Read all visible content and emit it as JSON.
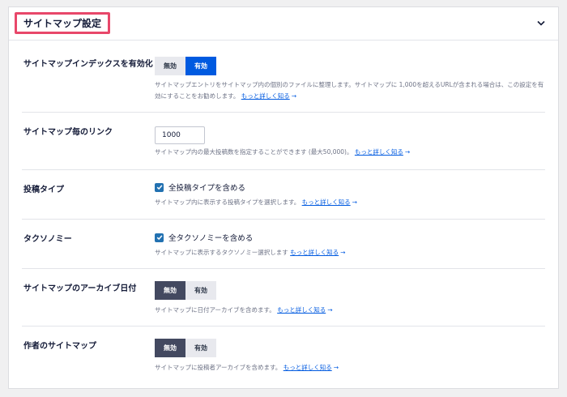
{
  "section": {
    "title": "サイトマップ設定",
    "collapse_icon": "chevron-down-icon"
  },
  "colors": {
    "accent": "#005ae0",
    "highlight_border": "#e8476a",
    "dark_toggle": "#434960"
  },
  "learn_more": "もっと詳しく知る",
  "arrow": "→",
  "rows": {
    "index": {
      "label": "サイトマップインデックスを有効化",
      "off": "無効",
      "on": "有効",
      "selected": "on",
      "desc": "サイトマップエントリをサイトマップ内の個別のファイルに整理します。サイトマップに 1,000を超えるURLが含まれる場合は、この設定を有効にすることをお勧めします。"
    },
    "links": {
      "label": "サイトマップ毎のリンク",
      "value": "1000",
      "desc": "サイトマップ内の最大投稿数を指定することができます (最大50,000)。"
    },
    "post_types": {
      "label": "投稿タイプ",
      "checkbox": "全投稿タイプを含める",
      "checked": true,
      "desc": "サイトマップ内に表示する投稿タイプを選択します。"
    },
    "taxonomies": {
      "label": "タクソノミー",
      "checkbox": "全タクソノミーを含める",
      "checked": true,
      "desc": "サイトマップに表示するタクソノミー選択します"
    },
    "archive": {
      "label": "サイトマップのアーカイブ日付",
      "off": "無効",
      "on": "有効",
      "selected": "off",
      "desc": "サイトマップに日付アーカイブを含めます。"
    },
    "author": {
      "label": "作者のサイトマップ",
      "off": "無効",
      "on": "有効",
      "selected": "off",
      "desc": "サイトマップに投稿者アーカイブを含めます。"
    }
  }
}
